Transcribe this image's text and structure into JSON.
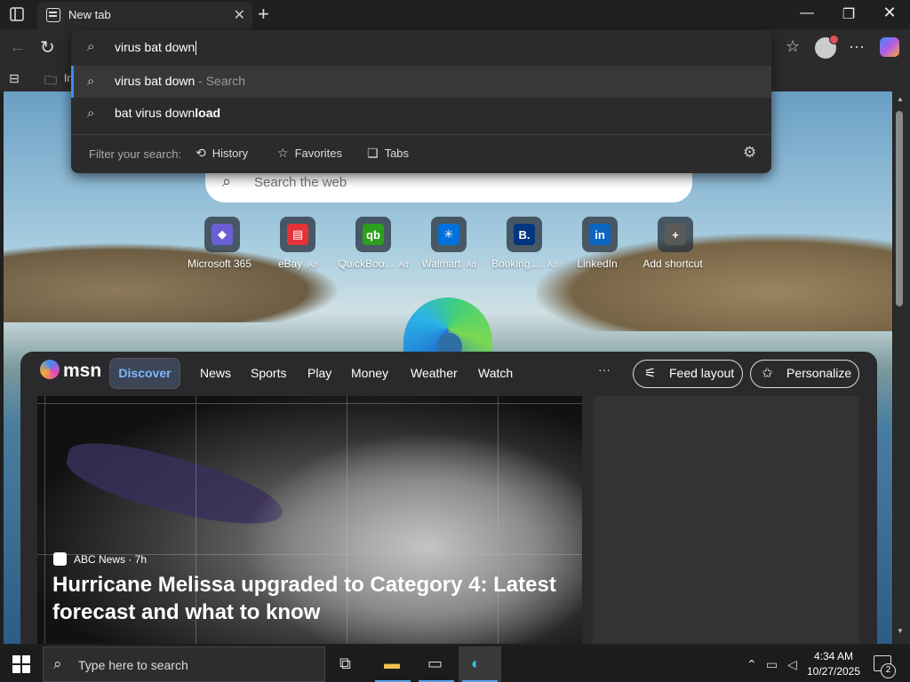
{
  "browser": {
    "tab_title": "New tab",
    "favorites_bar_item": "In"
  },
  "omnibox": {
    "input_value": "virus bat down",
    "suggestions": [
      {
        "text": "virus bat down",
        "suffix": " - Search"
      },
      {
        "text_normal": "bat virus down",
        "text_bold": "load"
      }
    ],
    "filter_label": "Filter your search:",
    "filters": [
      {
        "label": "History",
        "icon": "history-icon"
      },
      {
        "label": "Favorites",
        "icon": "star-icon"
      },
      {
        "label": "Tabs",
        "icon": "tabs-icon"
      }
    ]
  },
  "new_tab_page": {
    "search_placeholder": "Search the web",
    "shortcuts": [
      {
        "label": "Microsoft 365",
        "ad": "",
        "color": "#6b5fd6",
        "glyph": "◆"
      },
      {
        "label": "eBay",
        "ad": "Ad",
        "color": "#e53238",
        "glyph": "▤"
      },
      {
        "label": "QuickBoo...",
        "ad": "Ad",
        "color": "#2ca01c",
        "glyph": "qb"
      },
      {
        "label": "Walmart",
        "ad": "Ad",
        "color": "#0071dc",
        "glyph": "✳"
      },
      {
        "label": "Booking....",
        "ad": "Ad",
        "color": "#003580",
        "glyph": "B."
      },
      {
        "label": "LinkedIn",
        "ad": "",
        "color": "#0a66c2",
        "glyph": "in"
      },
      {
        "label": "Add shortcut",
        "ad": "",
        "color": "#5a5a5a",
        "glyph": "+"
      }
    ]
  },
  "msn": {
    "logo": "msn",
    "nav": [
      "Discover",
      "News",
      "Sports",
      "Play",
      "Money",
      "Weather",
      "Watch"
    ],
    "more": "···",
    "feed_layout": "Feed layout",
    "personalize": "Personalize",
    "hero": {
      "source": "ABC News · 7h",
      "title": "Hurricane Melissa upgraded to Category 4: Latest forecast and what to know"
    }
  },
  "taskbar": {
    "search_placeholder": "Type here to search",
    "time": "4:34 AM",
    "date": "10/27/2025",
    "notification_count": "2"
  }
}
